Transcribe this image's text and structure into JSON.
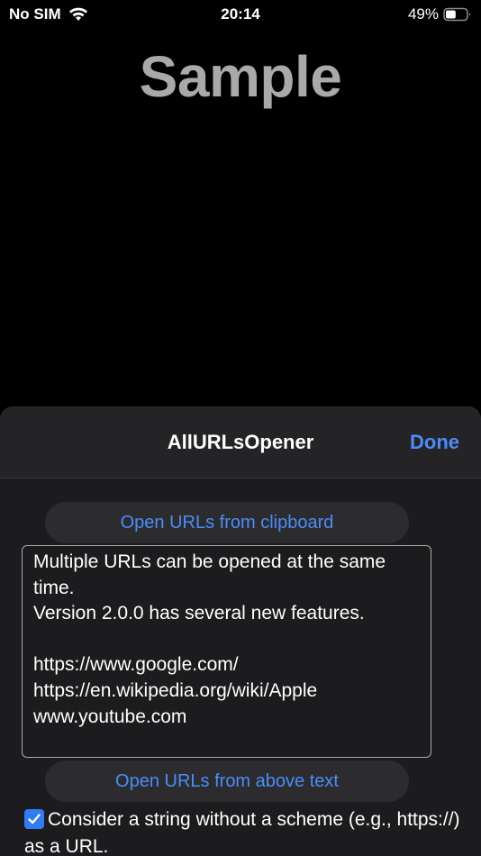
{
  "status": {
    "carrier": "No SIM",
    "time": "20:14",
    "battery": "49%",
    "battery_level": 0.49,
    "wifi_icon": "wifi-icon",
    "battery_icon": "battery-icon"
  },
  "background": {
    "title": "Sample"
  },
  "sheet": {
    "title": "AllURLsOpener",
    "done_label": "Done",
    "open_clipboard_label": "Open URLs from clipboard",
    "text_content": "Multiple URLs can be opened at the same time.\nVersion 2.0.0 has several new features.\n\nhttps://www.google.com/\nhttps://en.wikipedia.org/wiki/Apple\nwww.youtube.com",
    "open_text_label": "Open URLs from above text",
    "option_label": "Consider a string without a scheme (e.g., https://) as a URL.",
    "option_checked": true
  },
  "colors": {
    "accent": "#4a8df8",
    "checkbox": "#2f7cf6",
    "sheet_bg": "#1c1c1e",
    "button_bg": "#2c2c2e"
  }
}
